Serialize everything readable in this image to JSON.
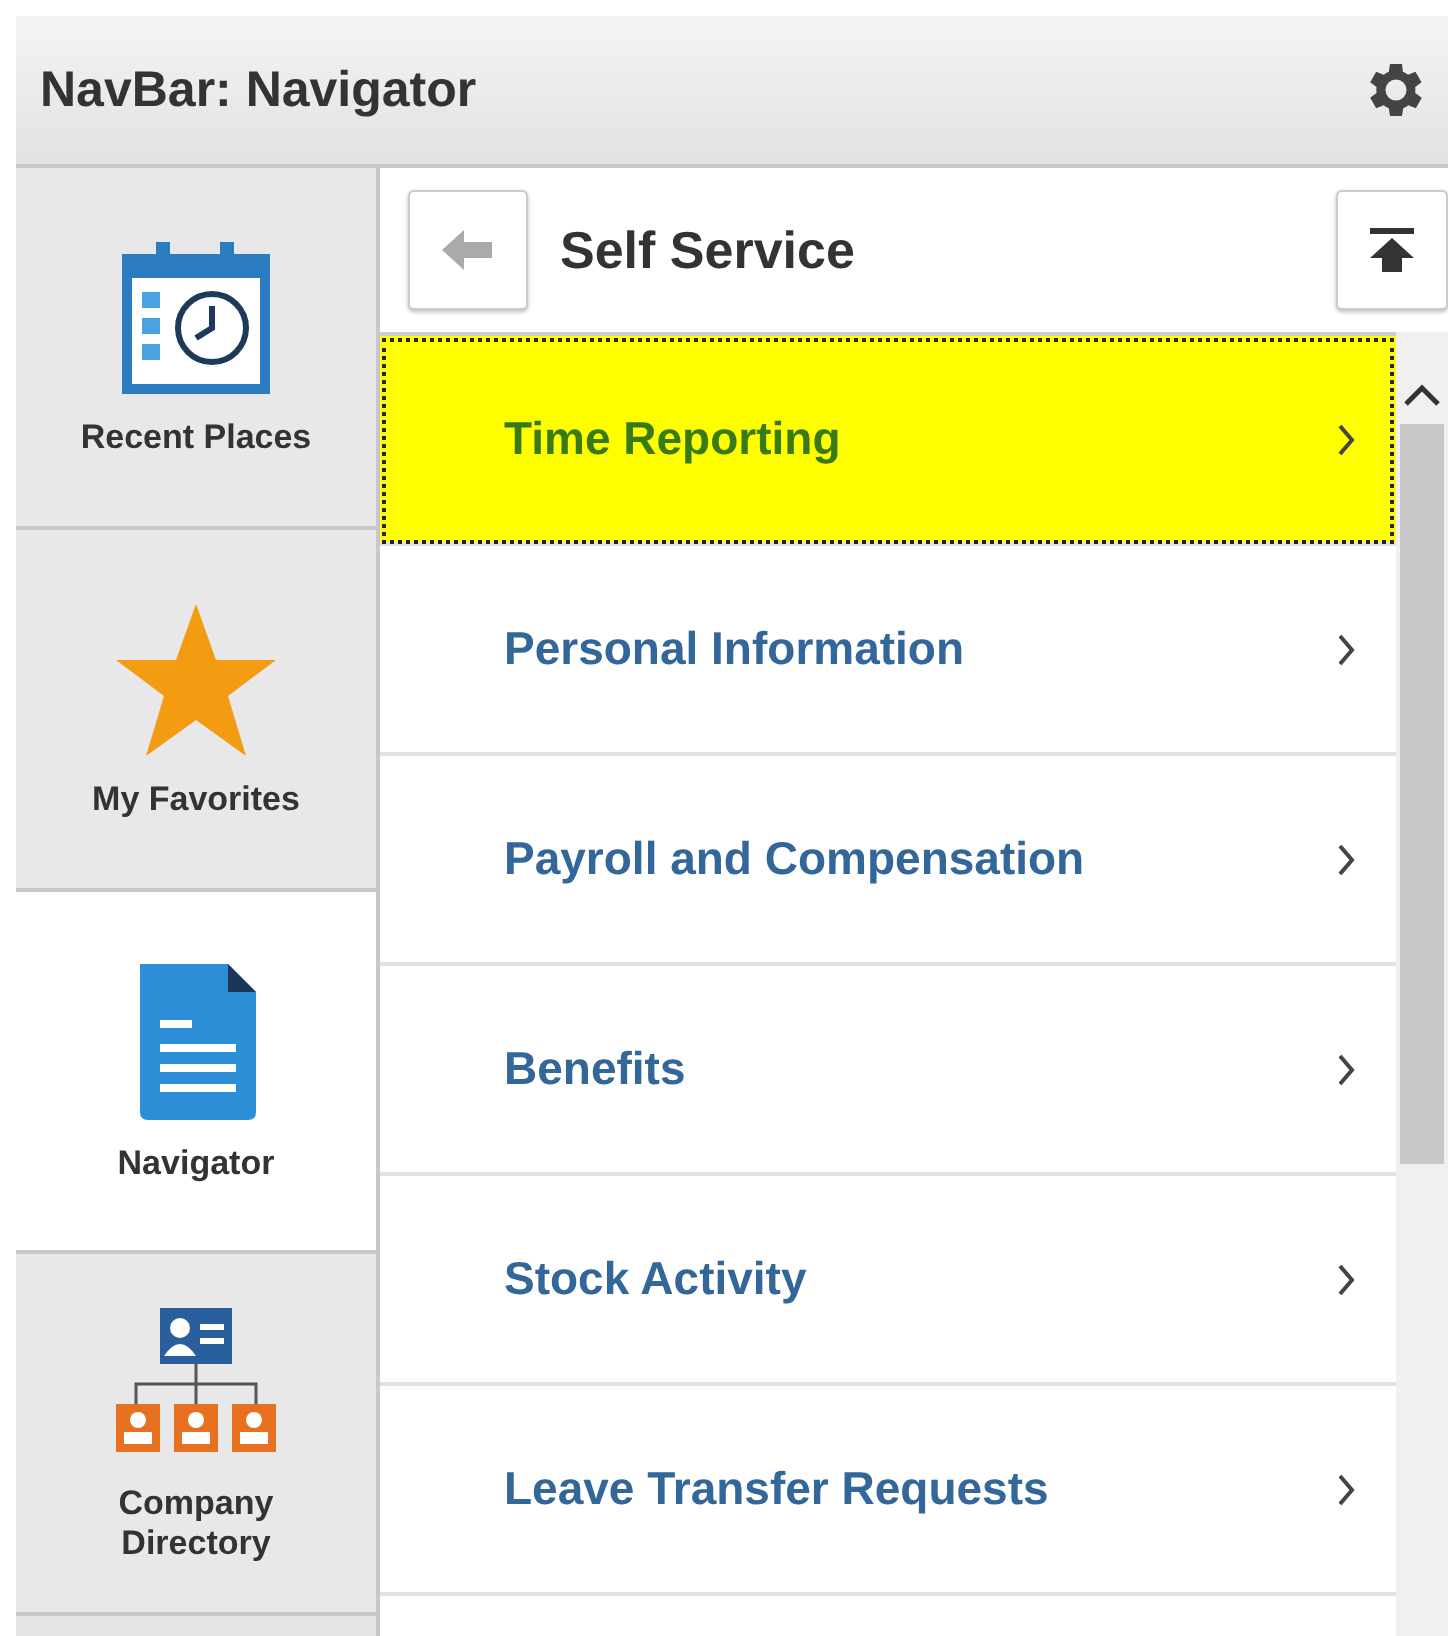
{
  "window": {
    "title": "NavBar: Navigator"
  },
  "sidebar": {
    "items": [
      {
        "label": "Recent Places",
        "kind": "recent",
        "selected": false
      },
      {
        "label": "My Favorites",
        "kind": "favorites",
        "selected": false
      },
      {
        "label": "Navigator",
        "kind": "navigator",
        "selected": true
      },
      {
        "label": "Company Directory",
        "kind": "directory",
        "selected": false
      }
    ]
  },
  "panel": {
    "title": "Self Service",
    "items": [
      {
        "label": "Time Reporting",
        "selected": true
      },
      {
        "label": "Personal Information",
        "selected": false
      },
      {
        "label": "Payroll and Compensation",
        "selected": false
      },
      {
        "label": "Benefits",
        "selected": false
      },
      {
        "label": "Stock Activity",
        "selected": false
      },
      {
        "label": "Leave Transfer Requests",
        "selected": false
      }
    ]
  }
}
